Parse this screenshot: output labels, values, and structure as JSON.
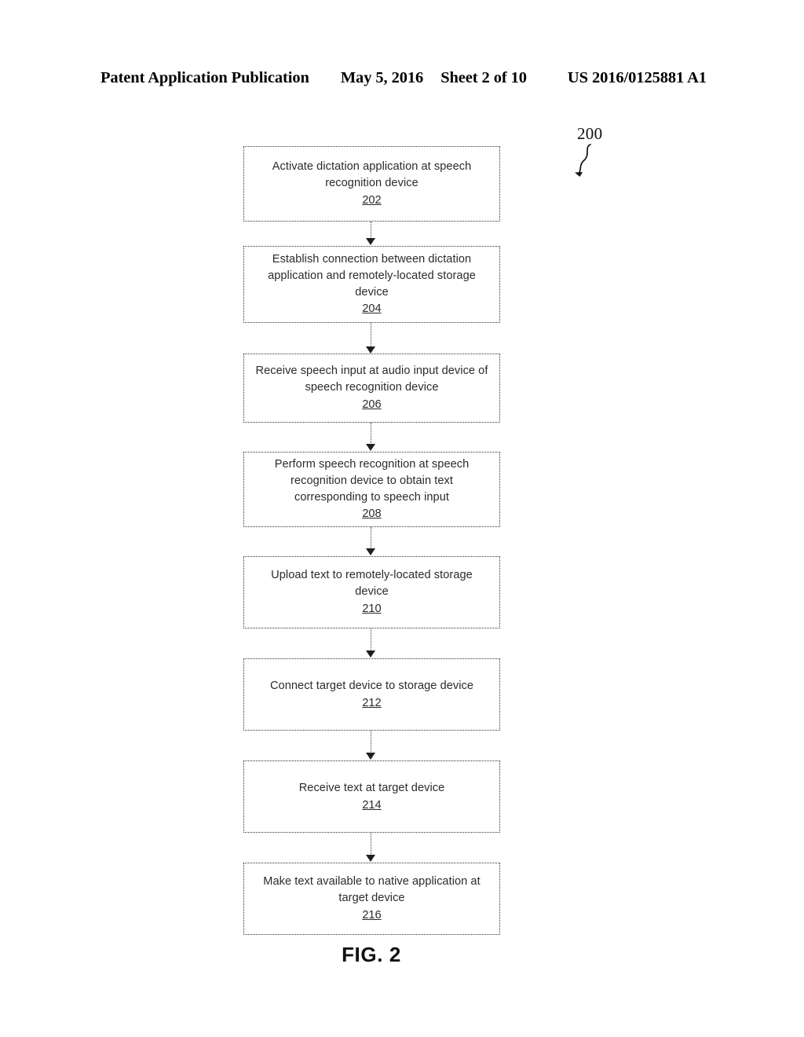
{
  "header": {
    "publication": "Patent Application Publication",
    "date": "May 5, 2016",
    "sheet": "Sheet 2 of 10",
    "patent_number": "US 2016/0125881 A1"
  },
  "figure": {
    "caption": "FIG. 2",
    "reference_label": "200",
    "leader_icon": "squiggle-leader-arrow-icon"
  },
  "flowchart": {
    "type": "flowchart",
    "orientation": "vertical",
    "node_count": 8,
    "nodes": [
      {
        "id": "202",
        "text": "Activate dictation application at speech recognition device",
        "ref": "202"
      },
      {
        "id": "204",
        "text": "Establish connection between dictation application and remotely-located storage device",
        "ref": "204"
      },
      {
        "id": "206",
        "text": "Receive speech input at audio input device of speech recognition device",
        "ref": "206"
      },
      {
        "id": "208",
        "text": "Perform speech recognition at speech recognition device to obtain text corresponding to speech input",
        "ref": "208"
      },
      {
        "id": "210",
        "text": "Upload text to remotely-located storage device",
        "ref": "210"
      },
      {
        "id": "212",
        "text": "Connect target device to storage device",
        "ref": "212"
      },
      {
        "id": "214",
        "text": "Receive text at target device",
        "ref": "214"
      },
      {
        "id": "216",
        "text": "Make text available to native application at target device",
        "ref": "216"
      }
    ],
    "connectors": [
      {
        "from": "202",
        "to": "204",
        "style": "dotted-arrow"
      },
      {
        "from": "204",
        "to": "206",
        "style": "dotted-arrow"
      },
      {
        "from": "206",
        "to": "208",
        "style": "dotted-arrow"
      },
      {
        "from": "208",
        "to": "210",
        "style": "dotted-arrow"
      },
      {
        "from": "210",
        "to": "212",
        "style": "dotted-arrow"
      },
      {
        "from": "212",
        "to": "214",
        "style": "dotted-arrow"
      },
      {
        "from": "214",
        "to": "216",
        "style": "dotted-arrow"
      }
    ]
  },
  "colors": {
    "background": "#ffffff",
    "ink": "#1a1a1a",
    "box_border": "#333333",
    "arrow": "#1f1f1f"
  }
}
